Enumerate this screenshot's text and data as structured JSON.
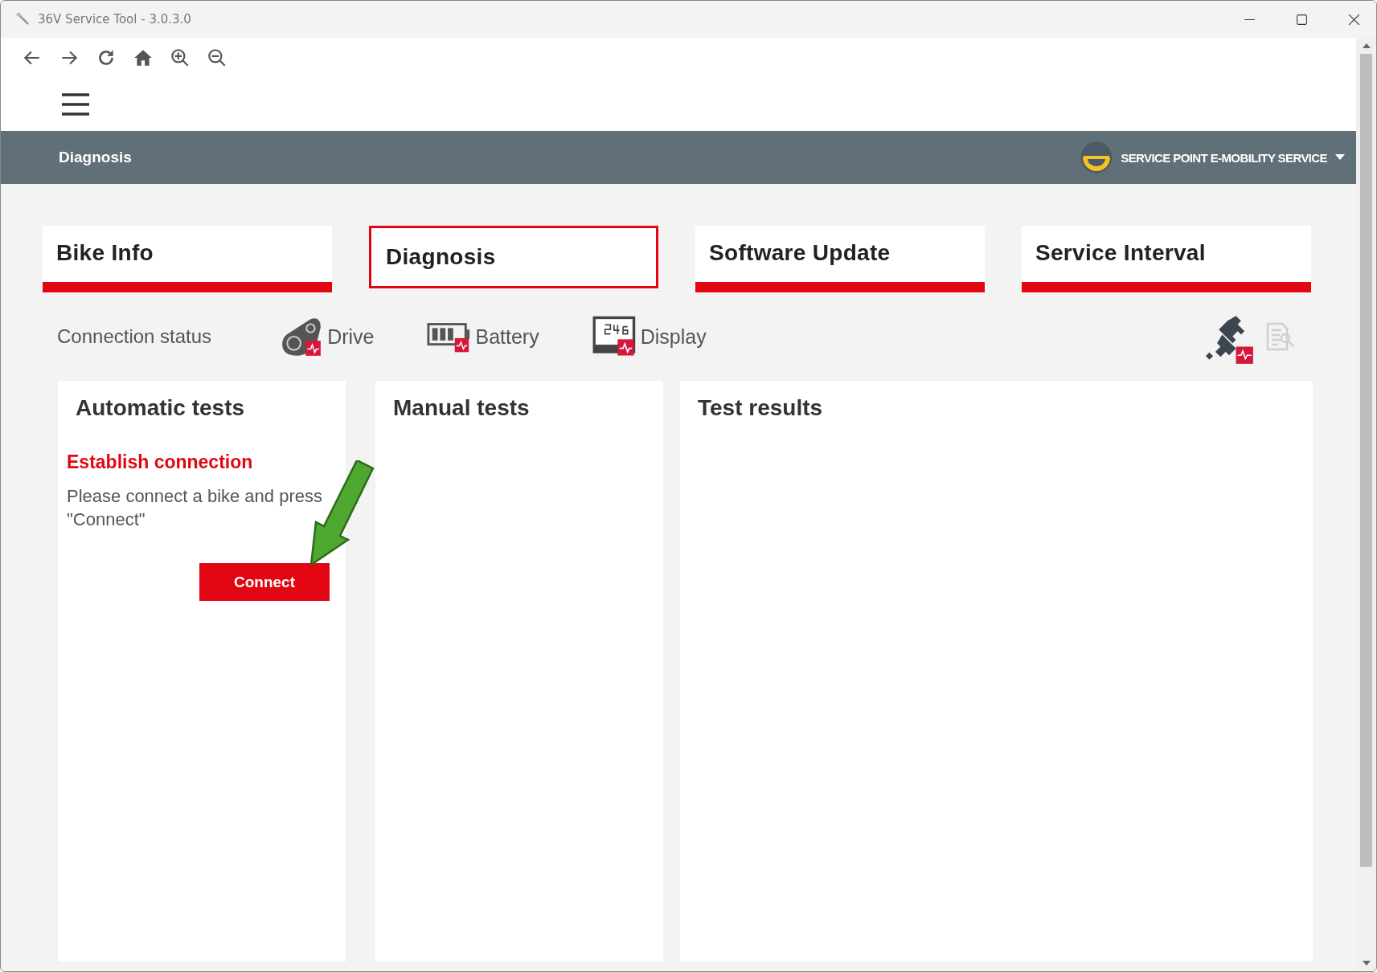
{
  "window": {
    "title": "36V Service Tool - 3.0.3.0"
  },
  "header": {
    "title": "Diagnosis",
    "account": "SERVICE POINT E-MOBILITY SERVICE"
  },
  "tabs": [
    {
      "label": "Bike Info",
      "selected": false
    },
    {
      "label": "Diagnosis",
      "selected": true
    },
    {
      "label": "Software Update",
      "selected": false
    },
    {
      "label": "Service Interval",
      "selected": false
    }
  ],
  "connection_status": {
    "label": "Connection status",
    "devices": [
      {
        "kind": "drive",
        "name": "Drive"
      },
      {
        "kind": "battery",
        "name": "Battery"
      },
      {
        "kind": "display",
        "name": "Display"
      }
    ]
  },
  "panels": [
    {
      "title": "Automatic tests",
      "subtitle": "Establish connection",
      "message": "Please connect a bike and press \"Connect\"",
      "button": "Connect"
    },
    {
      "title": "Manual tests"
    },
    {
      "title": "Test results"
    }
  ]
}
